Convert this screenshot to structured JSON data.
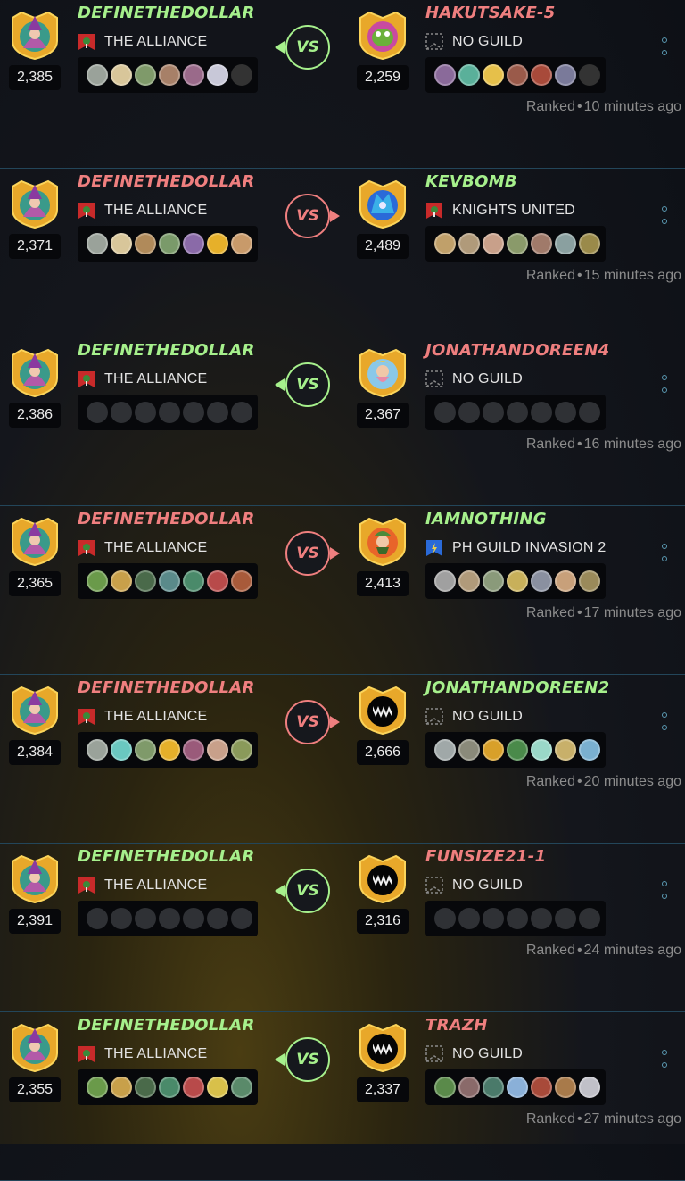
{
  "separator": "•",
  "colors": {
    "win": "#a6f08c",
    "lose": "#ef7f7f",
    "link_line": "#23465a"
  },
  "battles": [
    {
      "result": "win",
      "player": {
        "name": "DEFINETHEDOLLAR",
        "rating": "2,385",
        "guild": "THE ALLIANCE",
        "avatar": "wizard-avatar-icon",
        "team": [
          "#9aa29a",
          "#d8c69a",
          "#7f9a6a",
          "#a78068",
          "#9a6a8a",
          "#c8c8d8",
          "#333"
        ]
      },
      "opponent": {
        "name": "HAKUTSAKE-5",
        "rating": "2,259",
        "guild": "NO GUILD",
        "avatar": "dragon-avatar-icon",
        "team": [
          "#8a6a9a",
          "#5ab09a",
          "#e6c04a",
          "#9a5a4a",
          "#a84a3a",
          "#7a7a9a",
          "#333"
        ]
      },
      "vs": "VS",
      "mode": "Ranked",
      "time": "10 minutes ago"
    },
    {
      "result": "lose",
      "player": {
        "name": "DEFINETHEDOLLAR",
        "rating": "2,371",
        "guild": "THE ALLIANCE",
        "avatar": "wizard-avatar-icon",
        "team": [
          "#9aa29a",
          "#d8c69a",
          "#b08a5a",
          "#7a9a6a",
          "#8a6aa8",
          "#e6b02a",
          "#c89a6a"
        ]
      },
      "opponent": {
        "name": "KEVBOMB",
        "rating": "2,489",
        "guild": "KNIGHTS UNITED",
        "avatar": "golem-avatar-icon",
        "team": [
          "#c0a06a",
          "#b09a7a",
          "#c8a08a",
          "#8a9a6a",
          "#a07a6a",
          "#8aa0a0",
          "#9a8a4a"
        ]
      },
      "vs": "VS",
      "mode": "Ranked",
      "time": "15 minutes ago"
    },
    {
      "result": "win",
      "player": {
        "name": "DEFINETHEDOLLAR",
        "rating": "2,386",
        "guild": "THE ALLIANCE",
        "avatar": "wizard-avatar-icon",
        "team": [
          "#2f3135",
          "#2f3135",
          "#2f3135",
          "#2f3135",
          "#2f3135",
          "#2f3135",
          "#2f3135"
        ]
      },
      "opponent": {
        "name": "JONATHANDOREEN4",
        "rating": "2,367",
        "guild": "NO GUILD",
        "avatar": "fairy-avatar-icon",
        "team": [
          "#2f3135",
          "#2f3135",
          "#2f3135",
          "#2f3135",
          "#2f3135",
          "#2f3135",
          "#2f3135"
        ]
      },
      "vs": "VS",
      "mode": "Ranked",
      "time": "16 minutes ago"
    },
    {
      "result": "lose",
      "player": {
        "name": "DEFINETHEDOLLAR",
        "rating": "2,365",
        "guild": "THE ALLIANCE",
        "avatar": "wizard-avatar-icon",
        "team": [
          "#6a9a4a",
          "#c8a04a",
          "#4a6a4a",
          "#5a8a8a",
          "#4a8a6a",
          "#b84a4a",
          "#a85a3a"
        ]
      },
      "opponent": {
        "name": "IAMNOTHING",
        "rating": "2,413",
        "guild": "PH GUILD INVASION 2",
        "avatar": "warrior-avatar-icon",
        "team": [
          "#a0a0a0",
          "#b09a7a",
          "#8a9a7a",
          "#c8b05a",
          "#8a90a0",
          "#c8a07a",
          "#9a8a5a"
        ]
      },
      "vs": "VS",
      "mode": "Ranked",
      "time": "17 minutes ago"
    },
    {
      "result": "lose",
      "player": {
        "name": "DEFINETHEDOLLAR",
        "rating": "2,384",
        "guild": "THE ALLIANCE",
        "avatar": "wizard-avatar-icon",
        "team": [
          "#9aa29a",
          "#6ac8c0",
          "#7f9a6a",
          "#e6b02a",
          "#9a5a7a",
          "#c8a08a",
          "#8a9a5a"
        ]
      },
      "opponent": {
        "name": "JONATHANDOREEN2",
        "rating": "2,666",
        "guild": "NO GUILD",
        "avatar": "monster-mouth-avatar-icon",
        "team": [
          "#a0a8a8",
          "#8a8a7a",
          "#d8a02a",
          "#4a8a4a",
          "#9ad8c8",
          "#c8b06a",
          "#7ab0d0"
        ]
      },
      "vs": "VS",
      "mode": "Ranked",
      "time": "20 minutes ago"
    },
    {
      "result": "win",
      "player": {
        "name": "DEFINETHEDOLLAR",
        "rating": "2,391",
        "guild": "THE ALLIANCE",
        "avatar": "wizard-avatar-icon",
        "team": [
          "#2f3135",
          "#2f3135",
          "#2f3135",
          "#2f3135",
          "#2f3135",
          "#2f3135",
          "#2f3135"
        ]
      },
      "opponent": {
        "name": "FUNSIZE21-1",
        "rating": "2,316",
        "guild": "NO GUILD",
        "avatar": "monster-mouth-avatar-icon",
        "team": [
          "#2f3135",
          "#2f3135",
          "#2f3135",
          "#2f3135",
          "#2f3135",
          "#2f3135",
          "#2f3135"
        ]
      },
      "vs": "VS",
      "mode": "Ranked",
      "time": "24 minutes ago"
    },
    {
      "result": "win",
      "player": {
        "name": "DEFINETHEDOLLAR",
        "rating": "2,355",
        "guild": "THE ALLIANCE",
        "avatar": "wizard-avatar-icon",
        "team": [
          "#6a9a4a",
          "#c8a04a",
          "#4a6a4a",
          "#4a8a6a",
          "#b84a4a",
          "#d8c04a",
          "#5a8a6a"
        ]
      },
      "opponent": {
        "name": "TRAZH",
        "rating": "2,337",
        "guild": "NO GUILD",
        "avatar": "monster-mouth-avatar-icon",
        "team": [
          "#5a8a4a",
          "#8a6a6a",
          "#4a7a6a",
          "#8ab0d8",
          "#a84a3a",
          "#a87a4a",
          "#c0c0c8"
        ]
      },
      "vs": "VS",
      "mode": "Ranked",
      "time": "27 minutes ago"
    }
  ]
}
